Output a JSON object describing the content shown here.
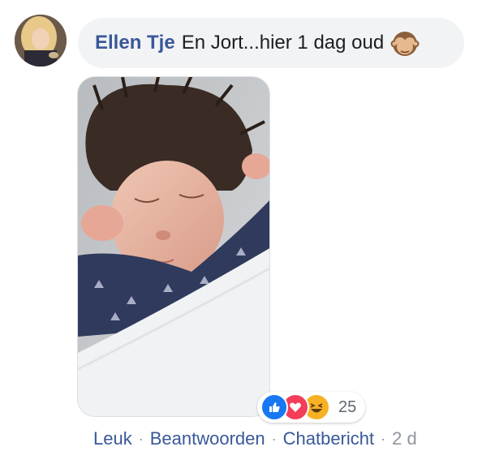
{
  "comment": {
    "author": "Ellen Tje",
    "text": "En Jort...hier 1 dag oud",
    "emoji": "see-no-evil-monkey"
  },
  "photo": {
    "subject": "newborn baby sleeping"
  },
  "reactions": {
    "icons": [
      "like-icon",
      "love-icon",
      "haha-icon"
    ],
    "count": "25"
  },
  "actions": {
    "like": "Leuk",
    "reply": "Beantwoorden",
    "message": "Chatbericht",
    "separator": "·",
    "time": "2 d"
  },
  "colors": {
    "link": "#385898",
    "bubble": "#f2f3f5",
    "like": "#1877f2",
    "love": "#f33e58",
    "haha": "#f7b125"
  }
}
